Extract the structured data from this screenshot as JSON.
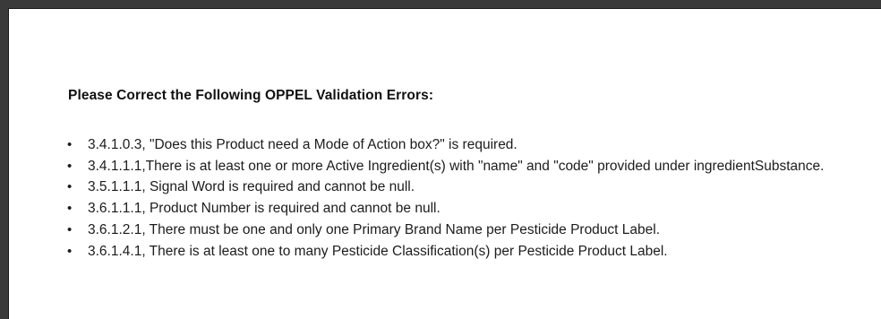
{
  "heading": "Please Correct the Following OPPEL Validation Errors:",
  "errors": [
    "3.4.1.0.3, \"Does this Product need a Mode of Action box?\" is required.",
    "3.4.1.1.1,There is at least one or more Active Ingredient(s) with \"name\" and \"code\" provided under ingredientSubstance.",
    "3.5.1.1.1, Signal Word is required and cannot be null.",
    "3.6.1.1.1, Product Number is required and cannot be null.",
    "3.6.1.2.1, There must be one and only one Primary Brand Name per Pesticide Product Label.",
    "3.6.1.4.1, There is at least one to many Pesticide Classification(s) per Pesticide Product Label."
  ],
  "bullet_char": "•"
}
